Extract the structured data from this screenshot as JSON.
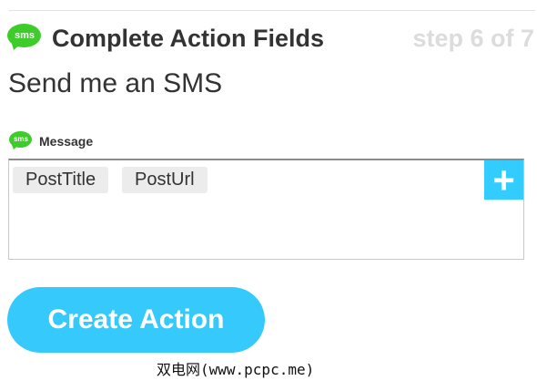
{
  "header": {
    "icon": "sms-icon",
    "icon_text": "sms",
    "title": "Complete Action Fields",
    "step": "step 6 of 7"
  },
  "action_name": "Send me an SMS",
  "field": {
    "icon": "sms-icon",
    "icon_text": "sms",
    "label": "Message",
    "tokens": [
      "PostTitle",
      "PostUrl"
    ],
    "add_label": "+"
  },
  "create_button_label": "Create Action",
  "watermark": "双电网(www.pcpc.me)",
  "colors": {
    "accent": "#36c9fb",
    "sms_green": "#3dcc2a",
    "step_text": "#dcdcdc",
    "text": "#333333"
  }
}
